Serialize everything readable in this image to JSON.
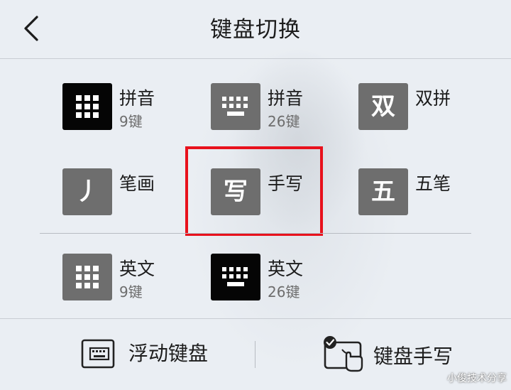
{
  "header": {
    "title": "键盘切换"
  },
  "keyboards": {
    "pinyin9": {
      "label": "拼音",
      "sub": "9键",
      "icon": "grid-9-icon"
    },
    "pinyin26": {
      "label": "拼音",
      "sub": "26键",
      "icon": "keyboard-26-icon"
    },
    "shuangpin": {
      "label": "双拼",
      "glyph": "双",
      "icon": "shuangpin-icon"
    },
    "bihua": {
      "label": "笔画",
      "glyph": "丿",
      "icon": "stroke-icon"
    },
    "shouxie": {
      "label": "手写",
      "glyph": "写",
      "icon": "handwriting-icon"
    },
    "wubi": {
      "label": "五笔",
      "glyph": "五",
      "icon": "wubi-icon"
    },
    "english9": {
      "label": "英文",
      "sub": "9键",
      "icon": "grid-9-icon"
    },
    "english26": {
      "label": "英文",
      "sub": "26键",
      "icon": "keyboard-26-icon"
    }
  },
  "bottom": {
    "floating": {
      "label": "浮动键盘",
      "icon": "floating-keyboard-icon"
    },
    "keyboard_handwriting": {
      "label": "键盘手写",
      "icon": "keyboard-handwriting-icon"
    }
  },
  "watermark": "小俊技术分享",
  "colors": {
    "highlight": "#e8111c",
    "tile": "#6e6e6e",
    "tile_selected": "#050505",
    "background": "#eaeef3"
  }
}
